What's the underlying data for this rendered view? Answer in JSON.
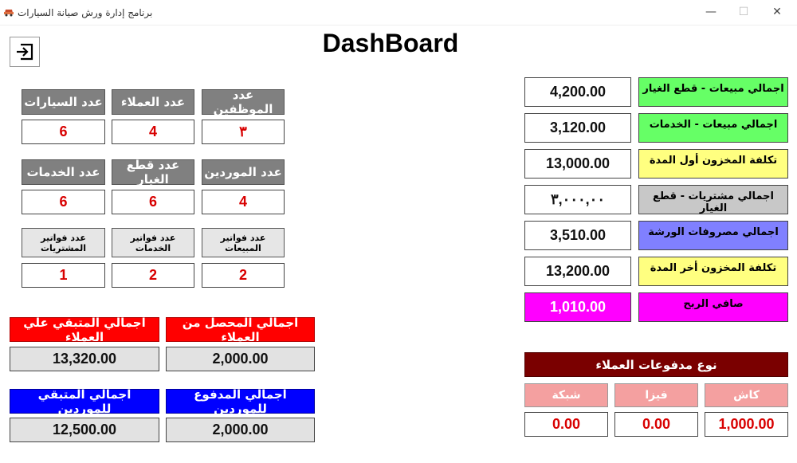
{
  "window": {
    "title": "برنامج إدارة ورش صيانة السيارات",
    "minimize": "—",
    "maximize": "☐",
    "close": "✕"
  },
  "page_title": "DashBoard",
  "counts": {
    "employees_label": "عدد الموظفين",
    "employees_value": "٣",
    "customers_label": "عدد العملاء",
    "customers_value": "4",
    "cars_label": "عدد السيارات",
    "cars_value": "6",
    "suppliers_label": "عدد الموردين",
    "suppliers_value": "4",
    "parts_label": "عدد قطع الغيار",
    "parts_value": "6",
    "services_label": "عدد الخدمات",
    "services_value": "6",
    "sales_invoices_label": "عدد فواتير المبيعات",
    "sales_invoices_value": "2",
    "service_invoices_label": "عدد فواتير الخدمات",
    "service_invoices_value": "2",
    "purchase_invoices_label": "عدد فواتير المشتريات",
    "purchase_invoices_value": "1"
  },
  "customers_totals": {
    "collected_label": "اجمالي المحصل من العملاء",
    "collected_value": "2,000.00",
    "remaining_label": "اجمالي المتبقي علي العملاء",
    "remaining_value": "13,320.00"
  },
  "suppliers_totals": {
    "paid_label": "اجمالي المدفوع للموردين",
    "paid_value": "2,000.00",
    "remaining_label": "اجمالي المتبقي للموردين",
    "remaining_value": "12,500.00"
  },
  "financials": [
    {
      "label": "اجمالي مبيعات - قطع الغيار",
      "value": "4,200.00",
      "color": "#66ff66"
    },
    {
      "label": "اجمالي مبيعات - الخدمات",
      "value": "3,120.00",
      "color": "#66ff66"
    },
    {
      "label": "تكلفة المخزون أول المدة",
      "value": "13,000.00",
      "color": "#ffff80"
    },
    {
      "label": "اجمالي مشتريات - قطع الغيار",
      "value": "٣,٠٠٠,٠٠",
      "color": "#c8c8c8"
    },
    {
      "label": "اجمالي مصروفات الورشة",
      "value": "3,510.00",
      "color": "#8080ff"
    },
    {
      "label": "تكلفة المخزون أخر المدة",
      "value": "13,200.00",
      "color": "#ffff80"
    }
  ],
  "net_profit": {
    "label": "صافي الربح",
    "value": "1,010.00",
    "color": "#ff00ff"
  },
  "payments": {
    "title": "نوع مدفوعات العملاء",
    "cash_label": "كاش",
    "cash_value": "1,000.00",
    "visa_label": "فيزا",
    "visa_value": "0.00",
    "network_label": "شبكة",
    "network_value": "0.00"
  },
  "colors": {
    "accent_red": "#d80000",
    "label_gray": "#808080",
    "maroon": "#7a0000",
    "pink": "#f4a0a0"
  }
}
